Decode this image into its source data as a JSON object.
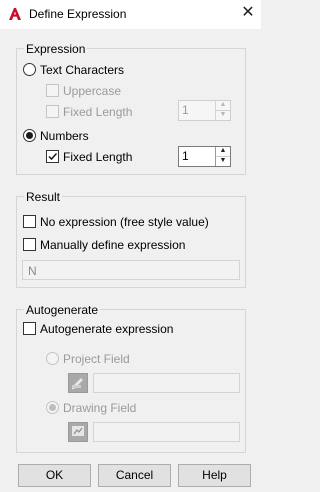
{
  "window": {
    "title": "Define Expression",
    "close_glyph": "✕"
  },
  "expression": {
    "group_label": "Expression",
    "text_characters": {
      "label": "Text Characters",
      "selected": false
    },
    "uppercase": {
      "label": "Uppercase",
      "checked": false,
      "enabled": false
    },
    "text_fixed_length": {
      "label": "Fixed Length",
      "checked": false,
      "enabled": false,
      "value": "1"
    },
    "numbers": {
      "label": "Numbers",
      "selected": true
    },
    "number_fixed_length": {
      "label": "Fixed Length",
      "checked": true,
      "enabled": true,
      "value": "1"
    }
  },
  "result": {
    "group_label": "Result",
    "no_expression": {
      "label": "No expression (free style value)",
      "checked": false
    },
    "manual_expression": {
      "label": "Manually define expression",
      "checked": false
    },
    "expression_value": "N"
  },
  "autogenerate": {
    "group_label": "Autogenerate",
    "autogenerate_expression": {
      "label": "Autogenerate expression",
      "checked": false
    },
    "project_field": {
      "label": "Project Field",
      "selected": false,
      "enabled": false,
      "value": ""
    },
    "drawing_field": {
      "label": "Drawing Field",
      "selected": true,
      "enabled": false,
      "value": ""
    }
  },
  "buttons": {
    "ok": "OK",
    "cancel": "Cancel",
    "help": "Help"
  },
  "colors": {
    "accent_red": "#c8102e",
    "dialog_bg": "#f0f0f0",
    "disabled_text": "#9a9a9a"
  },
  "icons": [
    "autocad-logo-icon",
    "close-icon",
    "project-field-picker-icon",
    "drawing-field-picker-icon",
    "spin-up-icon",
    "spin-down-icon",
    "checkmark-icon"
  ]
}
